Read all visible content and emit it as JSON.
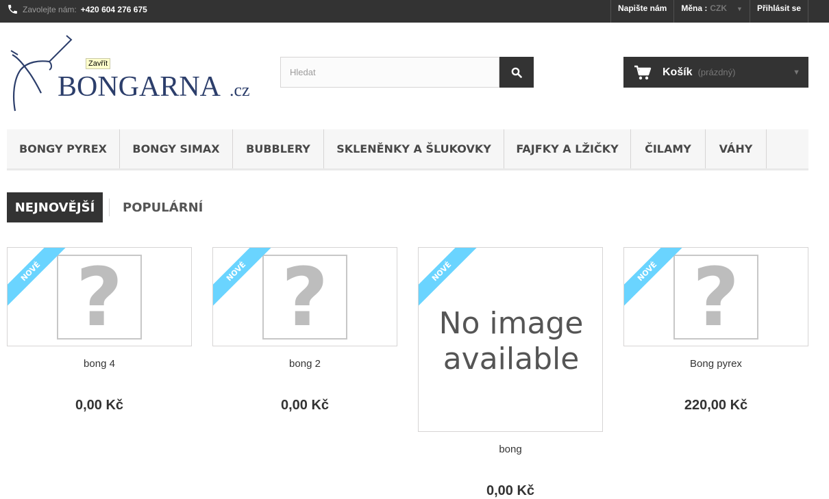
{
  "topbar": {
    "call_label": "Zavolejte nám:",
    "phone": "+420 604 276 675",
    "contact": "Napište nám",
    "currency_label": "Měna :",
    "currency_value": "CZK",
    "login": "Přihlásit se"
  },
  "logo": {
    "text": "BONGARNA",
    "suffix": ".cz"
  },
  "tooltip": "Zavřít",
  "search": {
    "placeholder": "Hledat"
  },
  "cart": {
    "title": "Košík",
    "status": "(prázdný)"
  },
  "menu": [
    {
      "label": "BONGY PYREX"
    },
    {
      "label": "BONGY SIMAX"
    },
    {
      "label": "BUBBLERY"
    },
    {
      "label": "SKLENĚNKY A ŠLUKOVKY"
    },
    {
      "label": "FAJFKY A LŽIČKY"
    },
    {
      "label": "ČILAMY"
    },
    {
      "label": "VÁHY"
    }
  ],
  "tabs": {
    "active": "NEJNOVĚJŠÍ",
    "other": "POPULÁRNÍ"
  },
  "badge": "NOVÉ",
  "no_image_text": [
    "No image",
    "available"
  ],
  "products": [
    {
      "name": "bong 4",
      "price": "0,00 Kč"
    },
    {
      "name": "bong 2",
      "price": "0,00 Kč"
    },
    {
      "name": "bong",
      "price": "0,00 Kč"
    },
    {
      "name": "Bong pyrex",
      "price": "220,00 Kč"
    }
  ],
  "colors": {
    "dark": "#333333",
    "ribbon": "#6ad4ff",
    "logo_blue": "#2c3e6b"
  },
  "icons": [
    "phone-icon",
    "search-icon",
    "cart-icon",
    "chevron-down-icon",
    "question-mark-icon"
  ]
}
